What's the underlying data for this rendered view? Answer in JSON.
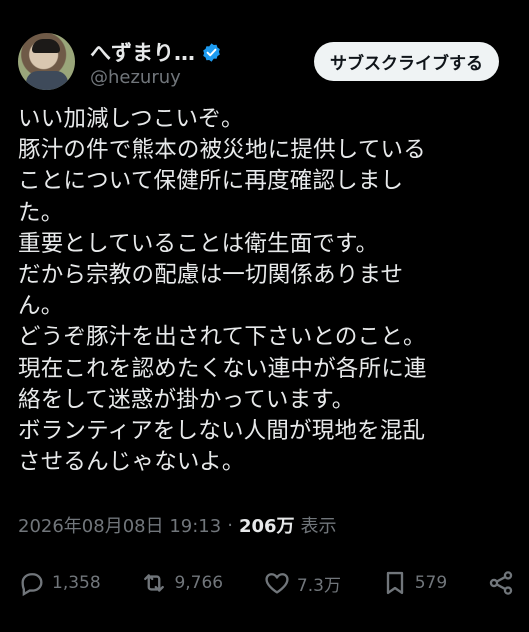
{
  "author": {
    "display_name": "へずまり…",
    "handle": "@hezuruy",
    "verified": true
  },
  "subscribe_label": "サブスクライブする",
  "post": {
    "lines": [
      "いい加減しつこいぞ。",
      "豚汁の件で熊本の被災地に提供している",
      "ことについて保健所に再度確認しまし",
      "た。",
      "重要としていることは衛生面です。",
      "だから宗教の配慮は一切関係ありませ",
      "ん。",
      "どうぞ豚汁を出されて下さいとのこと。",
      "現在これを認めたくない連中が各所に連",
      "絡をして迷惑が掛かっています。",
      "ボランティアをしない人間が現地を混乱",
      "させるんじゃないよ。"
    ]
  },
  "meta": {
    "timestamp": "2026年08月08日 19:13",
    "separator": "·",
    "views_count": "206万",
    "views_label": "表示"
  },
  "actions": {
    "replies": "1,358",
    "reposts": "9,766",
    "likes": "7.3万",
    "bookmarks": "579"
  },
  "colors": {
    "background": "#000000",
    "text": "#e7e9ea",
    "secondary": "#71767b",
    "verified": "#1d9bf0",
    "button_bg": "#eff3f4"
  }
}
